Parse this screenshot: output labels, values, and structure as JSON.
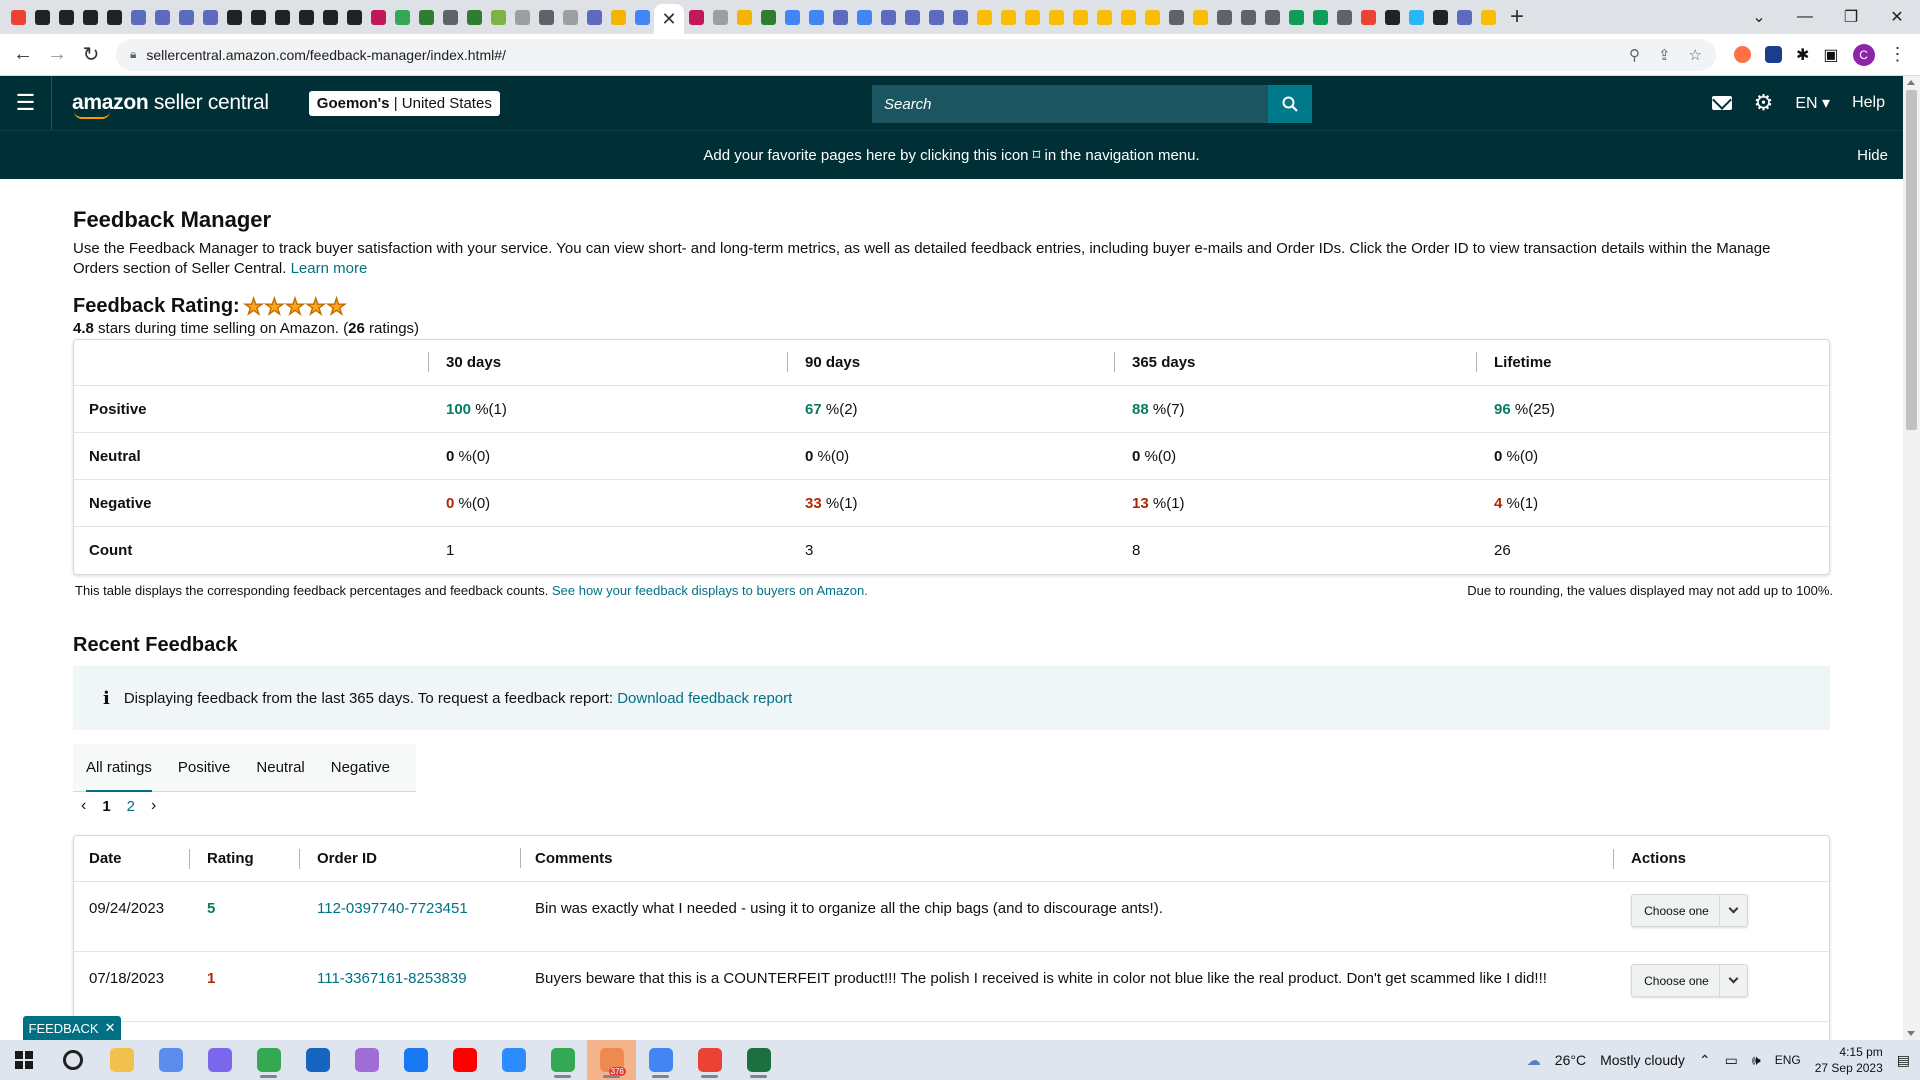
{
  "browser": {
    "tab_favicon_colors": [
      "#ea4335",
      "#222",
      "#222",
      "#222",
      "#222",
      "#5c6bc0",
      "#5c6bc0",
      "#5c6bc0",
      "#5c6bc0",
      "#222",
      "#222",
      "#222",
      "#222",
      "#222",
      "#222",
      "#c2185b",
      "#34a853",
      "#2e7d32",
      "#5f6368",
      "#2e7d32",
      "#7cb342",
      "#9e9e9e",
      "#5f6368",
      "#9e9e9e",
      "#5c6bc0",
      "#f4b400",
      "#4285f4"
    ],
    "tab_favicon_colors_right": [
      "#c2185b",
      "#9e9e9e",
      "#f4b400",
      "#2e7d32",
      "#4285f4",
      "#4285f4",
      "#5c6bc0",
      "#4285f4",
      "#5c6bc0",
      "#5c6bc0",
      "#5c6bc0",
      "#5c6bc0",
      "#fbbc04",
      "#fbbc04",
      "#fbbc04",
      "#fbbc04",
      "#fbbc04",
      "#fbbc04",
      "#fbbc04",
      "#fbbc04",
      "#5f6368",
      "#fbbc04",
      "#5f6368",
      "#5f6368",
      "#5f6368",
      "#0f9d58",
      "#0f9d58",
      "#5f6368",
      "#ea4335",
      "#222",
      "#29b6f6",
      "#222",
      "#5c6bc0",
      "#fbbc04"
    ],
    "active_tab_close": "✕",
    "new_tab": "+",
    "url": "sellercentral.amazon.com/feedback-manager/index.html#/",
    "profile_initial": "C"
  },
  "header": {
    "logo_text_bold": "amazon",
    "logo_text": " seller central",
    "store_name": "Goemon's",
    "store_separator": " | ",
    "store_region": "United States",
    "search_placeholder": "Search",
    "language": "EN",
    "help": "Help"
  },
  "fav_bar": {
    "message": "Add your favorite pages here by clicking this icon ⌑ in the navigation menu.",
    "hide": "Hide"
  },
  "page": {
    "title": "Feedback Manager",
    "intro": "Use the Feedback Manager to track buyer satisfaction with your service. You can view short- and long-term metrics, as well as detailed feedback entries, including buyer e-mails and Order IDs. Click the Order ID to view transaction details within the Manage Orders section of Seller Central.",
    "learn_more": "Learn more",
    "rating_title": "Feedback Rating:",
    "stars": 5,
    "rating_value": "4.8",
    "rating_text_mid": " stars during time selling on Amazon. (",
    "rating_count": "26",
    "rating_text_end": " ratings)"
  },
  "metrics": {
    "columns": [
      "",
      "30 days",
      "90 days",
      "365 days",
      "Lifetime"
    ],
    "rows": [
      {
        "label": "Positive",
        "cells": [
          {
            "v": "100",
            "c": "(1)"
          },
          {
            "v": "67",
            "c": "(2)"
          },
          {
            "v": "88",
            "c": "(7)"
          },
          {
            "v": "96",
            "c": "(25)"
          }
        ]
      },
      {
        "label": "Neutral",
        "cells": [
          {
            "v": "0",
            "c": "(0)"
          },
          {
            "v": "0",
            "c": "(0)"
          },
          {
            "v": "0",
            "c": "(0)"
          },
          {
            "v": "0",
            "c": "(0)"
          }
        ]
      },
      {
        "label": "Negative",
        "cells": [
          {
            "v": "0",
            "c": "(0)"
          },
          {
            "v": "33",
            "c": "(1)"
          },
          {
            "v": "13",
            "c": "(1)"
          },
          {
            "v": "4",
            "c": "(1)"
          }
        ]
      }
    ],
    "count_label": "Count",
    "counts": [
      "1",
      "3",
      "8",
      "26"
    ],
    "pct_unit": " %",
    "note": "This table displays the corresponding feedback percentages and feedback counts.",
    "note_link": "See how your feedback displays to buyers on Amazon.",
    "rounding_note": "Due to rounding, the values displayed may not add up to 100%."
  },
  "recent": {
    "title": "Recent Feedback",
    "alert_text": "Displaying feedback from the last 365 days. To request a feedback report:",
    "alert_link": "Download feedback report",
    "tabs": [
      "All ratings",
      "Positive",
      "Neutral",
      "Negative"
    ],
    "pages": [
      "1",
      "2"
    ],
    "columns": [
      "Date",
      "Rating",
      "Order ID",
      "Comments",
      "Actions"
    ],
    "rows": [
      {
        "date": "09/24/2023",
        "rating": "5",
        "order": "112-0397740-7723451",
        "comment": "Bin was exactly what I needed - using it to organize all the chip bags (and to discourage ants!).",
        "action": "Choose one"
      },
      {
        "date": "07/18/2023",
        "rating": "1",
        "order": "111-3367161-8253839",
        "comment": "Buyers beware that this is a COUNTERFEIT product!!! The polish I received is white in color not blue like the real product. Don't get scammed like I did!!!",
        "action": "Choose one"
      }
    ],
    "feedback_tab": "FEEDBACK",
    "feedback_tab_close": "✕"
  },
  "taskbar": {
    "weather_temp": "26°C",
    "weather_text": "Mostly cloudy",
    "lang": "ENG",
    "time": "4:15 pm",
    "date": "27 Sep 2023",
    "app_colors": [
      "#222",
      "#f0c14b",
      "#5b8def",
      "#7b68ee",
      "#34a853",
      "#1565c0",
      "#a06cd5",
      "#1877f2",
      "#ff0000",
      "#2d8cff",
      "#34a853",
      "#ef8a4f",
      "#4285f4",
      "#ea4335",
      "#1d6f42"
    ],
    "telegram_badge": "376"
  }
}
